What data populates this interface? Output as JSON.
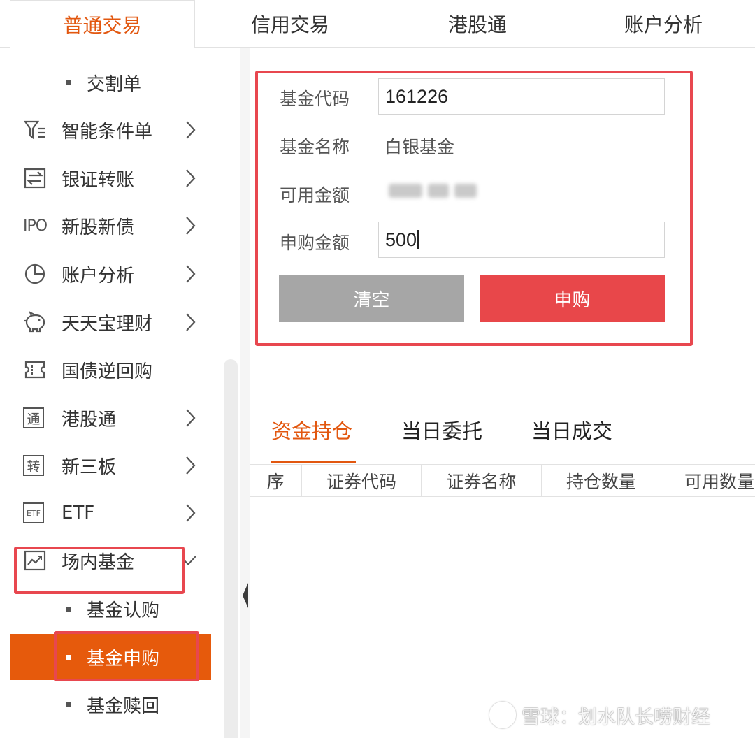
{
  "top_tabs": [
    {
      "label": "普通交易",
      "active": true
    },
    {
      "label": "信用交易",
      "active": false
    },
    {
      "label": "港股通",
      "active": false
    },
    {
      "label": "账户分析",
      "active": false
    }
  ],
  "sidebar": {
    "partial_sub_item": "交割单",
    "items": [
      {
        "label": "智能条件单",
        "icon": "filter-list-icon",
        "chevron": "right"
      },
      {
        "label": "银证转账",
        "icon": "transfer-arrows-icon",
        "chevron": "right"
      },
      {
        "label": "新股新债",
        "icon": "ipo-icon",
        "icon_text": "IPO",
        "chevron": "right"
      },
      {
        "label": "账户分析",
        "icon": "pie-chart-icon",
        "chevron": "right"
      },
      {
        "label": "天天宝理财",
        "icon": "piggy-bank-icon",
        "chevron": "right"
      },
      {
        "label": "国债逆回购",
        "icon": "ticket-icon",
        "chevron": "none"
      },
      {
        "label": "港股通",
        "icon": "hk-connect-icon",
        "icon_text": "通",
        "chevron": "right"
      },
      {
        "label": "新三板",
        "icon": "neeq-icon",
        "icon_text": "转",
        "chevron": "right"
      },
      {
        "label": "ETF",
        "icon": "etf-icon",
        "icon_text": "ETF",
        "chevron": "right"
      },
      {
        "label": "场内基金",
        "icon": "trend-chart-icon",
        "chevron": "check"
      }
    ],
    "sub_items": [
      {
        "label": "基金认购",
        "active": false
      },
      {
        "label": "基金申购",
        "active": true
      },
      {
        "label": "基金赎回",
        "active": false
      }
    ]
  },
  "form": {
    "code_label": "基金代码",
    "code_value": "161226",
    "name_label": "基金名称",
    "name_value": "白银基金",
    "available_label": "可用金额",
    "amount_label": "申购金额",
    "amount_value": "500",
    "clear_button": "清空",
    "buy_button": "申购"
  },
  "position_tabs": [
    {
      "label": "资金持仓",
      "active": true
    },
    {
      "label": "当日委托",
      "active": false
    },
    {
      "label": "当日成交",
      "active": false
    }
  ],
  "table_headers": [
    "序",
    "证券代码",
    "证券名称",
    "持仓数量",
    "可用数量"
  ],
  "watermark": "雪球：划水队长唠财经",
  "colors": {
    "accent_orange": "#e2570f",
    "active_item_bg": "#e65a0c",
    "buy_red": "#e8474a",
    "clear_gray": "#a6a6a6",
    "highlight_red": "#e8474f"
  }
}
